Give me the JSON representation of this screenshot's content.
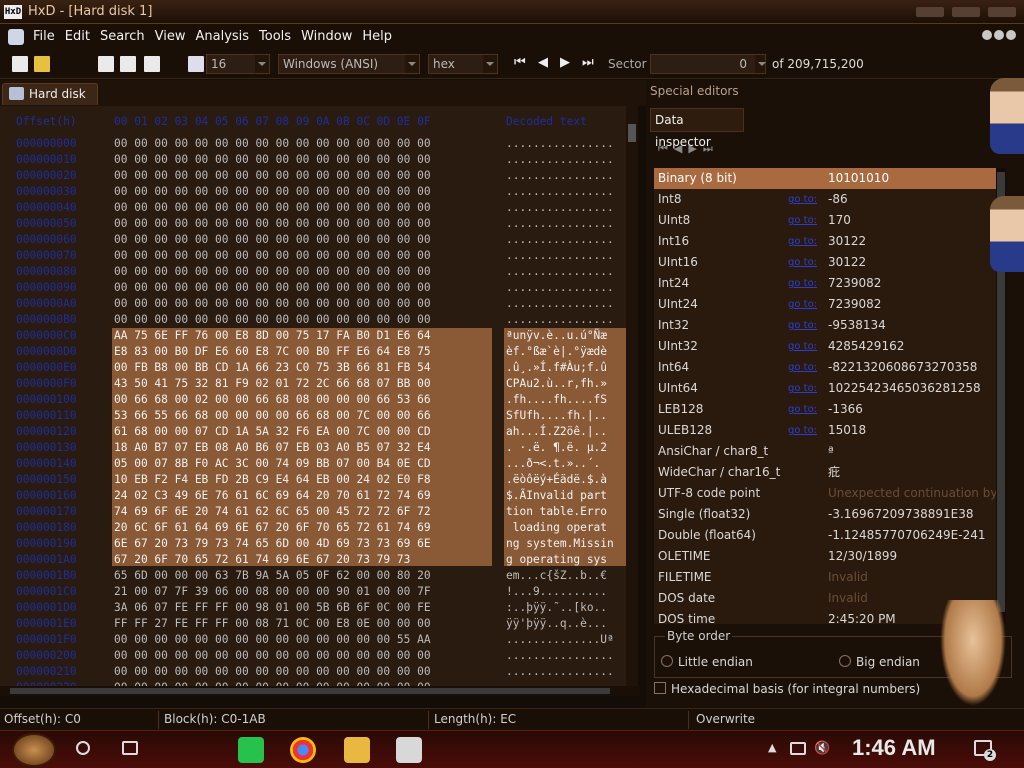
{
  "window": {
    "title": "HxD - [Hard disk 1]",
    "logo_text": "HxD"
  },
  "menu": [
    "File",
    "Edit",
    "Search",
    "View",
    "Analysis",
    "Tools",
    "Window",
    "Help"
  ],
  "toolbar": {
    "bytes_per_row": "16",
    "charset": "Windows (ANSI)",
    "offset_base": "hex",
    "sector_label": "Sector",
    "sector_value": "0",
    "sector_total": "of 209,715,200"
  },
  "tab": {
    "label": "Hard disk 1"
  },
  "hex_header": {
    "offset": "Offset(h)",
    "columns": "00 01 02 03 04 05 06 07 08 09 0A 0B 0C 0D 0E 0F",
    "text": "Decoded text"
  },
  "hex_rows": [
    {
      "off": "000000000",
      "hex": "00 00 00 00 00 00 00 00 00 00 00 00 00 00 00 00",
      "txt": "................"
    },
    {
      "off": "000000010",
      "hex": "00 00 00 00 00 00 00 00 00 00 00 00 00 00 00 00",
      "txt": "................"
    },
    {
      "off": "000000020",
      "hex": "00 00 00 00 00 00 00 00 00 00 00 00 00 00 00 00",
      "txt": "................"
    },
    {
      "off": "000000030",
      "hex": "00 00 00 00 00 00 00 00 00 00 00 00 00 00 00 00",
      "txt": "................"
    },
    {
      "off": "000000040",
      "hex": "00 00 00 00 00 00 00 00 00 00 00 00 00 00 00 00",
      "txt": "................"
    },
    {
      "off": "000000050",
      "hex": "00 00 00 00 00 00 00 00 00 00 00 00 00 00 00 00",
      "txt": "................"
    },
    {
      "off": "000000060",
      "hex": "00 00 00 00 00 00 00 00 00 00 00 00 00 00 00 00",
      "txt": "................"
    },
    {
      "off": "000000070",
      "hex": "00 00 00 00 00 00 00 00 00 00 00 00 00 00 00 00",
      "txt": "................"
    },
    {
      "off": "000000080",
      "hex": "00 00 00 00 00 00 00 00 00 00 00 00 00 00 00 00",
      "txt": "................"
    },
    {
      "off": "000000090",
      "hex": "00 00 00 00 00 00 00 00 00 00 00 00 00 00 00 00",
      "txt": "................"
    },
    {
      "off": "0000000A0",
      "hex": "00 00 00 00 00 00 00 00 00 00 00 00 00 00 00 00",
      "txt": "................"
    },
    {
      "off": "0000000B0",
      "hex": "00 00 00 00 00 00 00 00 00 00 00 00 00 00 00 00",
      "txt": "................"
    },
    {
      "off": "0000000C0",
      "hex": "AA 75 6E FF 76 00 E8 8D 00 75 17 FA B0 D1 E6 64",
      "txt": "ªunÿv.è..u.ú°Ñæ"
    },
    {
      "off": "0000000D0",
      "hex": "E8 83 00 B0 DF E6 60 E8 7C 00 B0 FF E6 64 E8 75",
      "txt": "èf.°ßæ`è|.°ÿædè"
    },
    {
      "off": "0000000E0",
      "hex": "00 FB B8 00 BB CD 1A 66 23 C0 75 3B 66 81 FB 54",
      "txt": ".û¸.»Í.f#Àu;f.û"
    },
    {
      "off": "0000000F0",
      "hex": "43 50 41 75 32 81 F9 02 01 72 2C 66 68 07 BB 00",
      "txt": "CPAu2.ù..r,fh.»"
    },
    {
      "off": "000000100",
      "hex": "00 66 68 00 02 00 00 66 68 08 00 00 00 66 53 66",
      "txt": ".fh....fh....fS"
    },
    {
      "off": "000000110",
      "hex": "53 66 55 66 68 00 00 00 00 66 68 00 7C 00 00 66",
      "txt": "SfUfh....fh.|.."
    },
    {
      "off": "000000120",
      "hex": "61 68 00 00 07 CD 1A 5A 32 F6 EA 00 7C 00 00 CD",
      "txt": "ah...Í.Z2öê.|.."
    },
    {
      "off": "000000130",
      "hex": "18 A0 B7 07 EB 08 A0 B6 07 EB 03 A0 B5 07 32 E4",
      "txt": ". ·.ë. ¶.ë. µ.2"
    },
    {
      "off": "000000140",
      "hex": "05 00 07 8B F0 AC 3C 00 74 09 BB 07 00 B4 0E CD",
      "txt": "...ð¬<.t.»..´."
    },
    {
      "off": "000000150",
      "hex": "10 EB F2 F4 EB FD 2B C9 E4 64 EB 00 24 02 E0 F8",
      "txt": ".ëòôëý+Éädë.$.à"
    },
    {
      "off": "000000160",
      "hex": "24 02 C3 49 6E 76 61 6C 69 64 20 70 61 72 74 69",
      "txt": "$.ÃInvalid part"
    },
    {
      "off": "000000170",
      "hex": "74 69 6F 6E 20 74 61 62 6C 65 00 45 72 72 6F 72",
      "txt": "tion table.Erro"
    },
    {
      "off": "000000180",
      "hex": "20 6C 6F 61 64 69 6E 67 20 6F 70 65 72 61 74 69",
      "txt": " loading operat"
    },
    {
      "off": "000000190",
      "hex": "6E 67 20 73 79 73 74 65 6D 00 4D 69 73 73 69 6E",
      "txt": "ng system.Missin"
    },
    {
      "off": "0000001A0",
      "hex": "67 20 6F 70 65 72 61 74 69 6E 67 20 73 79 73",
      "txt": "g operating sys"
    },
    {
      "off": "0000001B0",
      "hex": "65 6D 00 00 00 63 7B 9A 5A 05 0F 62 00 00 80 20",
      "txt": "em...c{šZ..b..€"
    },
    {
      "off": "0000001C0",
      "hex": "21 00 07 7F 39 06 00 08 00 00 00 90 01 00 00 7F",
      "txt": "!...9.........."
    },
    {
      "off": "0000001D0",
      "hex": "3A 06 07 FE FF FF 00 98 01 00 5B 6B 6F 0C 00 FE",
      "txt": ":..þÿÿ.˜..[ko.."
    },
    {
      "off": "0000001E0",
      "hex": "FF FF 27 FE FF FF 00 08 71 0C 00 E8 0E 00 00 00",
      "txt": "ÿÿ'þÿÿ..q..è..."
    },
    {
      "off": "0000001F0",
      "hex": "00 00 00 00 00 00 00 00 00 00 00 00 00 00 55 AA",
      "txt": "..............Uª"
    },
    {
      "off": "000000200",
      "hex": "00 00 00 00 00 00 00 00 00 00 00 00 00 00 00 00",
      "txt": "................"
    },
    {
      "off": "000000210",
      "hex": "00 00 00 00 00 00 00 00 00 00 00 00 00 00 00 00",
      "txt": "................"
    },
    {
      "off": "000000220",
      "hex": "00 00 00 00 00 00 00 00 00 00 00 00 00 00 00 00",
      "txt": "................"
    }
  ],
  "selection": {
    "first_row": 12,
    "last_row": 26
  },
  "right_pane": {
    "title": "Special editors",
    "tab": "Data inspector"
  },
  "inspector_link_text": "go to:",
  "inspector": [
    {
      "label": "Binary (8 bit)",
      "value": "10101010",
      "link": false,
      "dim": false
    },
    {
      "label": "Int8",
      "value": "-86",
      "link": true,
      "dim": false
    },
    {
      "label": "UInt8",
      "value": "170",
      "link": true,
      "dim": false
    },
    {
      "label": "Int16",
      "value": "30122",
      "link": true,
      "dim": false
    },
    {
      "label": "UInt16",
      "value": "30122",
      "link": true,
      "dim": false
    },
    {
      "label": "Int24",
      "value": "7239082",
      "link": true,
      "dim": false
    },
    {
      "label": "UInt24",
      "value": "7239082",
      "link": true,
      "dim": false
    },
    {
      "label": "Int32",
      "value": "-9538134",
      "link": true,
      "dim": false
    },
    {
      "label": "UInt32",
      "value": "4285429162",
      "link": true,
      "dim": false
    },
    {
      "label": "Int64",
      "value": "-8221320608673270358",
      "link": true,
      "dim": false
    },
    {
      "label": "UInt64",
      "value": "10225423465036281258",
      "link": true,
      "dim": false
    },
    {
      "label": "LEB128",
      "value": "-1366",
      "link": true,
      "dim": false
    },
    {
      "label": "ULEB128",
      "value": "15018",
      "link": true,
      "dim": false
    },
    {
      "label": "AnsiChar / char8_t",
      "value": "ª",
      "link": false,
      "dim": false
    },
    {
      "label": "WideChar / char16_t",
      "value": "疪",
      "link": false,
      "dim": false
    },
    {
      "label": "UTF-8 code point",
      "value": "Unexpected continuation byte",
      "link": false,
      "dim": true
    },
    {
      "label": "Single (float32)",
      "value": "-3.16967209738891E38",
      "link": false,
      "dim": false
    },
    {
      "label": "Double (float64)",
      "value": "-1.12485770706249E-241",
      "link": false,
      "dim": false
    },
    {
      "label": "OLETIME",
      "value": "12/30/1899",
      "link": false,
      "dim": false
    },
    {
      "label": "FILETIME",
      "value": "Invalid",
      "link": false,
      "dim": true
    },
    {
      "label": "DOS date",
      "value": "Invalid",
      "link": false,
      "dim": true
    },
    {
      "label": "DOS time",
      "value": "2:45:20 PM",
      "link": false,
      "dim": false
    }
  ],
  "byte_order": {
    "title": "Byte order",
    "little": "Little endian",
    "big": "Big endian"
  },
  "hex_basis": "Hexadecimal basis (for integral numbers)",
  "status": {
    "offset": "Offset(h): C0",
    "block": "Block(h): C0-1AB",
    "length": "Length(h): EC",
    "mode": "Overwrite"
  },
  "taskbar": {
    "clock": "1:46 AM",
    "notifications": "2"
  },
  "colors": {
    "selection": "#8a5a36",
    "offset_text": "#1c2e9e",
    "inspector_highlight": "#a86a3e"
  }
}
